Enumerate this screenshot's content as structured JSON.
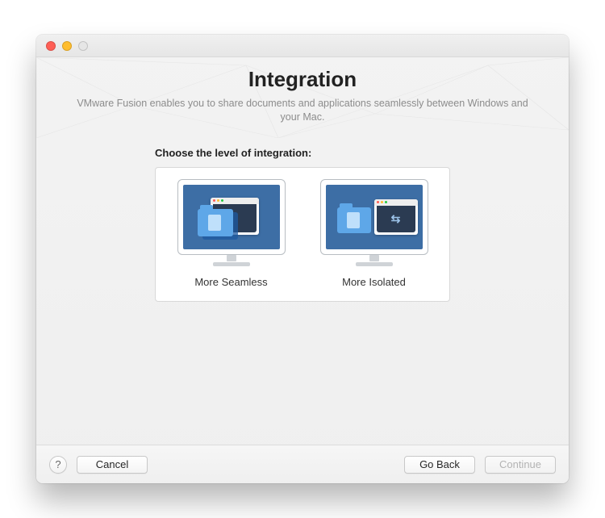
{
  "header": {
    "title": "Integration",
    "subtitle": "VMware Fusion enables you to share documents and applications seamlessly between Windows and your Mac."
  },
  "main": {
    "choose_label": "Choose the level of integration:",
    "options": {
      "seamless": {
        "label": "More Seamless"
      },
      "isolated": {
        "label": "More Isolated"
      }
    }
  },
  "footer": {
    "help": "?",
    "cancel": "Cancel",
    "goback": "Go Back",
    "cont": "Continue",
    "continue_enabled": false
  }
}
